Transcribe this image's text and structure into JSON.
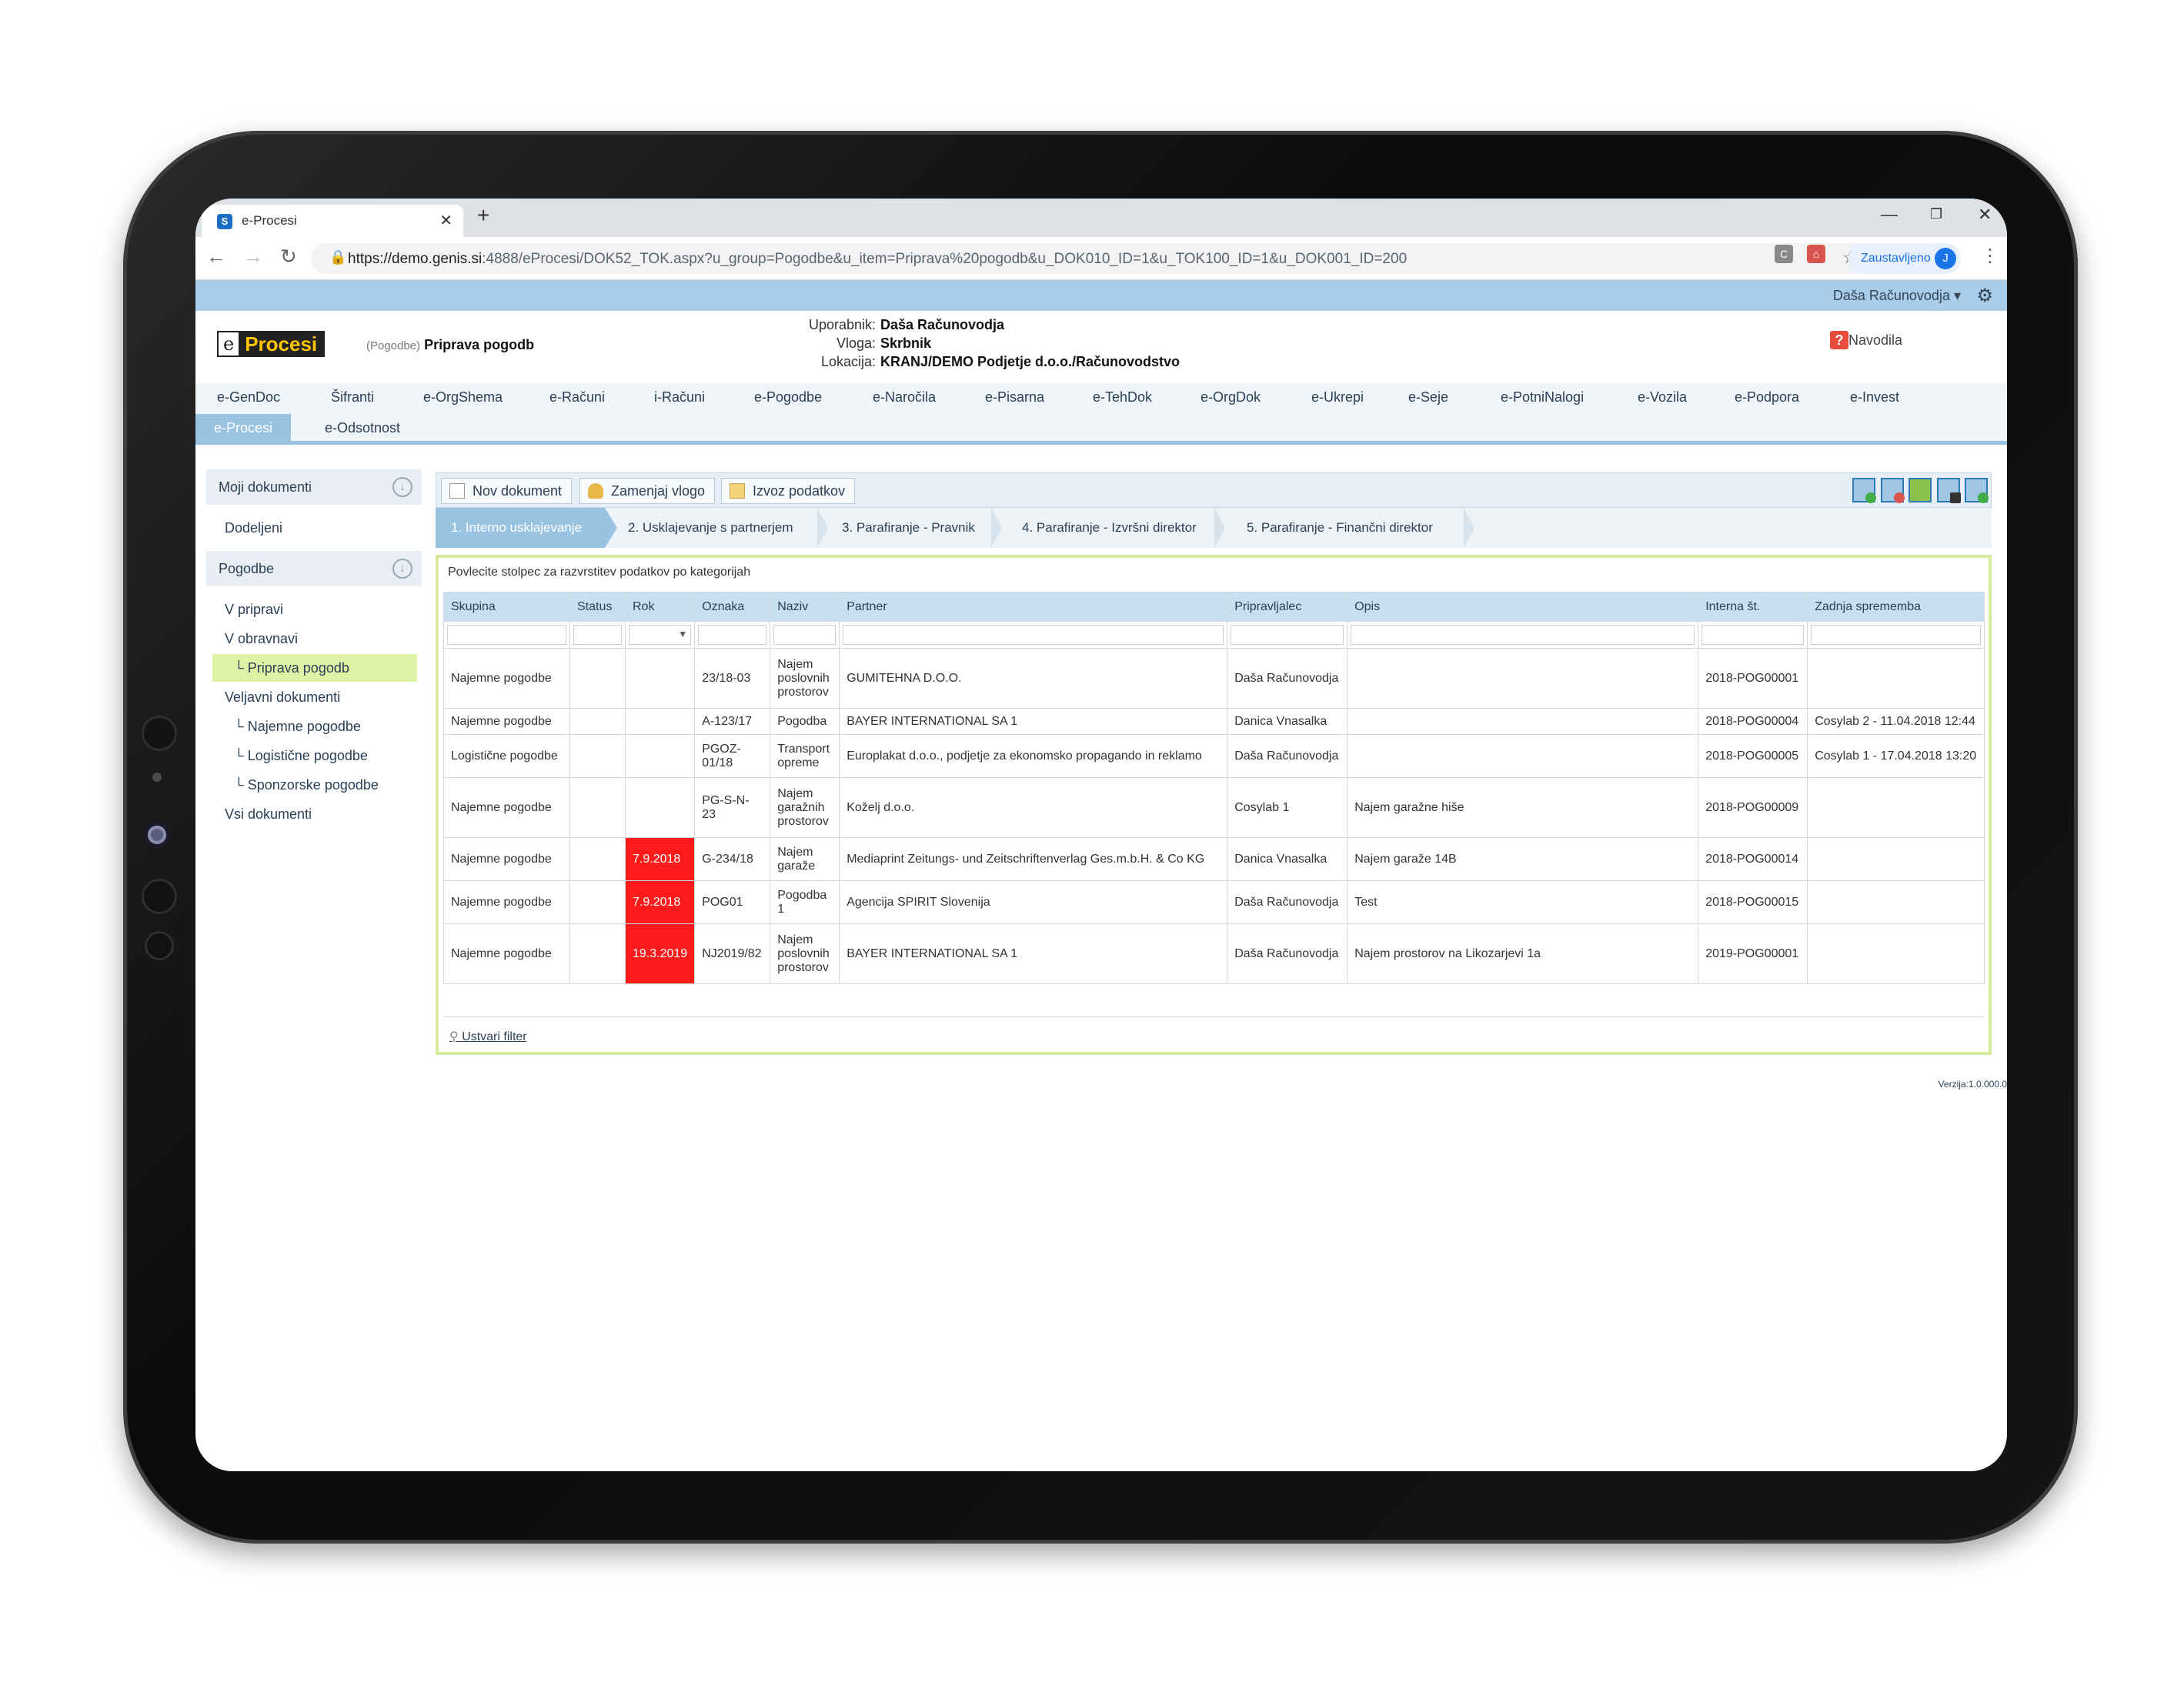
{
  "browser": {
    "tab_title": "e-Procesi",
    "tab_favicon": "S",
    "url_host": "https://demo.genis.si",
    "url_path": ":4888/eProcesi/DOK52_TOK.aspx?u_group=Pogodbe&u_item=Priprava%20pogodb&u_DOK010_ID=1&u_TOK100_ID=1&u_DOK001_ID=200",
    "profile_label": "Zaustavljeno",
    "profile_initial": "J"
  },
  "app": {
    "user_menu": "Daša Računovodja ▾",
    "logo_e": "e",
    "logo_text": "Procesi",
    "breadcrumb_group": "(Pogodbe)",
    "breadcrumb_item": "Priprava pogodb",
    "user_label": "Uporabnik:",
    "user_value": "Daša Računovodja",
    "role_label": "Vloga:",
    "role_value": "Skrbnik",
    "location_label": "Lokacija:",
    "location_value": "KRANJ/DEMO Podjetje d.o.o./Računovodstvo",
    "help_label": "Navodila",
    "version": "Verzija:1.0.000.0"
  },
  "modules_row1": [
    "e-GenDoc",
    "Šifranti",
    "e-OrgShema",
    "e-Računi",
    "i-Računi",
    "e-Pogodbe",
    "e-Naročila",
    "e-Pisarna",
    "e-TehDok",
    "e-OrgDok",
    "e-Ukrepi",
    "e-Seje",
    "e-PotniNalogi",
    "e-Vozila",
    "e-Podpora",
    "e-Invest"
  ],
  "modules_row2": [
    "e-Procesi",
    "e-Odsotnost"
  ],
  "sidebar": {
    "group1": "Moji dokumenti",
    "group1_items": [
      "Dodeljeni"
    ],
    "group2": "Pogodbe",
    "items": [
      "V pripravi",
      "V obravnavi",
      "Priprava pogodb",
      "Veljavni dokumenti",
      "Najemne pogodbe",
      "Logistične pogodbe",
      "Sponzorske pogodbe",
      "Vsi dokumenti"
    ]
  },
  "toolbar": {
    "new_doc": "Nov dokument",
    "swap_role": "Zamenjaj vlogo",
    "export": "Izvoz podatkov"
  },
  "steps": [
    "1. Interno usklajevanje",
    "2. Usklajevanje s partnerjem",
    "3. Parafiranje - Pravnik",
    "4. Parafiranje - Izvršni direktor",
    "5. Parafiranje - Finančni direktor"
  ],
  "grid": {
    "group_hint": "Povlecite stolpec za razvrstitev podatkov po kategorijah",
    "columns": [
      "Skupina",
      "Status",
      "Rok",
      "Oznaka",
      "Naziv",
      "Partner",
      "Pripravljalec",
      "Opis",
      "Interna št.",
      "Zadnja sprememba"
    ],
    "rows": [
      [
        "Najemne pogodbe",
        "",
        "",
        "23/18-03",
        "Najem poslovnih prostorov",
        "GUMITEHNA D.O.O.",
        "Daša Računovodja",
        "",
        "2018-POG00001",
        ""
      ],
      [
        "Najemne pogodbe",
        "",
        "",
        "A-123/17",
        "Pogodba",
        "BAYER INTERNATIONAL SA 1",
        "Danica Vnasalka",
        "",
        "2018-POG00004",
        "Cosylab 2 - 11.04.2018 12:44"
      ],
      [
        "Logistične pogodbe",
        "",
        "",
        "PGOZ-01/18",
        "Transport opreme",
        "Europlakat d.o.o., podjetje za ekonomsko propagando in reklamo",
        "Daša Računovodja",
        "",
        "2018-POG00005",
        "Cosylab 1 - 17.04.2018 13:20"
      ],
      [
        "Najemne pogodbe",
        "",
        "",
        "PG-S-N-23",
        "Najem garažnih prostorov",
        "Koželj d.o.o.",
        "Cosylab 1",
        "Najem garažne hiše",
        "2018-POG00009",
        ""
      ],
      [
        "Najemne pogodbe",
        "",
        "7.9.2018",
        "G-234/18",
        "Najem garaže",
        "Mediaprint Zeitungs- und Zeitschriftenverlag Ges.m.b.H. & Co KG",
        "Danica Vnasalka",
        "Najem garaže 14B",
        "2018-POG00014",
        ""
      ],
      [
        "Najemne pogodbe",
        "",
        "7.9.2018",
        "POG01",
        "Pogodba 1",
        "Agencija SPIRIT Slovenija",
        "Daša Računovodja",
        "Test",
        "2018-POG00015",
        ""
      ],
      [
        "Najemne pogodbe",
        "",
        "19.3.2019",
        "NJ2019/82",
        "Najem poslovnih prostorov",
        "BAYER INTERNATIONAL SA 1",
        "Daša Računovodja",
        "Najem prostorov na Likozarjevi 1a",
        "2019-POG00001",
        ""
      ]
    ],
    "filter_link": "Ustvari filter"
  },
  "colors": {
    "accent": "#9ac3e2",
    "overdue": "#ff1b1b",
    "selected": "#dff3a6",
    "grid_border": "#d6eb9c"
  }
}
